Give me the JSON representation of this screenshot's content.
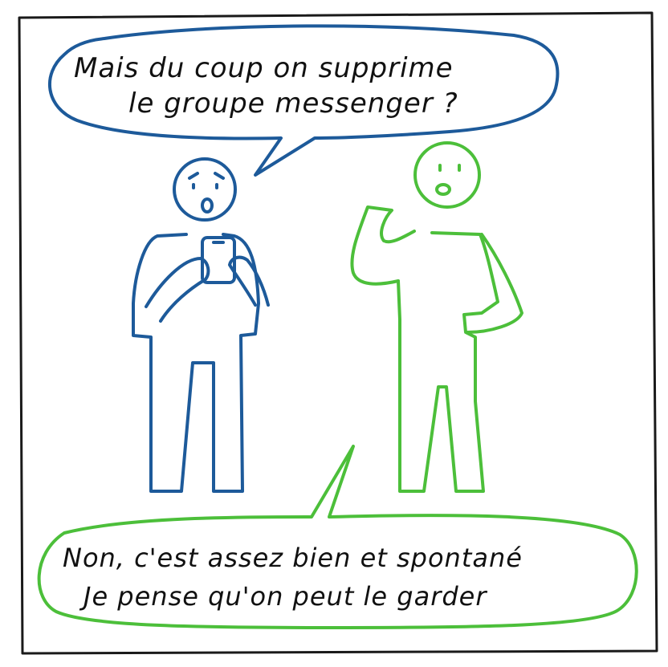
{
  "panel": {
    "bubble_top": {
      "line1": "Mais du coup on supprime",
      "line2": "le groupe messenger ?"
    },
    "bubble_bottom": {
      "line1": "Non, c'est assez bien et spontané",
      "line2": "Je pense qu'on peut le garder"
    }
  },
  "colors": {
    "border": "#1a1a1a",
    "blue_character": "#1d5a9a",
    "green_character": "#4cbf3a",
    "text": "#111111"
  }
}
